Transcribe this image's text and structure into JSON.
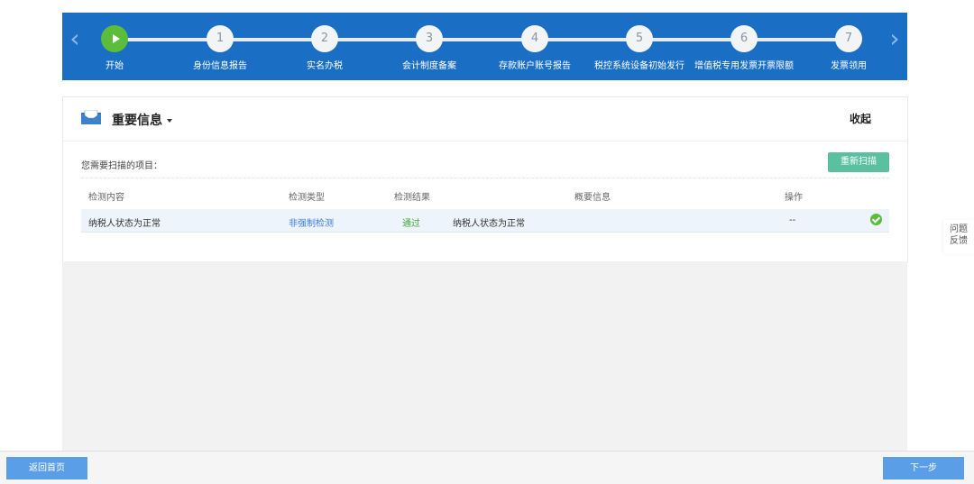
{
  "stepper": {
    "steps": [
      {
        "num": "",
        "label": "开始"
      },
      {
        "num": "1",
        "label": "身份信息报告"
      },
      {
        "num": "2",
        "label": "实名办税"
      },
      {
        "num": "3",
        "label": "会计制度备案"
      },
      {
        "num": "4",
        "label": "存款账户账号报告"
      },
      {
        "num": "5",
        "label": "税控系统设备初始发行"
      },
      {
        "num": "6",
        "label": "增值税专用发票开票限额"
      },
      {
        "num": "7",
        "label": "发票领用"
      }
    ]
  },
  "panel": {
    "title": "重要信息",
    "collapse_label": "收起",
    "scan_label": "您需要扫描的项目：",
    "rescan_label": "重新扫描",
    "columns": [
      "检测内容",
      "检测类型",
      "检测结果",
      "概要信息",
      "操作"
    ],
    "rows": [
      {
        "content": "纳税人状态为正常",
        "type": "非强制检测",
        "result": "通过",
        "summary": "纳税人状态为正常",
        "action": "--"
      }
    ]
  },
  "feedback": {
    "line1": "问题",
    "line2": "反馈"
  },
  "footer": {
    "home_label": "返回首页",
    "next_label": "下一步"
  },
  "colors": {
    "stepper_bg": "#1a6fc5",
    "active_step": "#5bbd3a",
    "button_blue": "#5a9ee8",
    "rescan_green": "#5bc0a0"
  }
}
